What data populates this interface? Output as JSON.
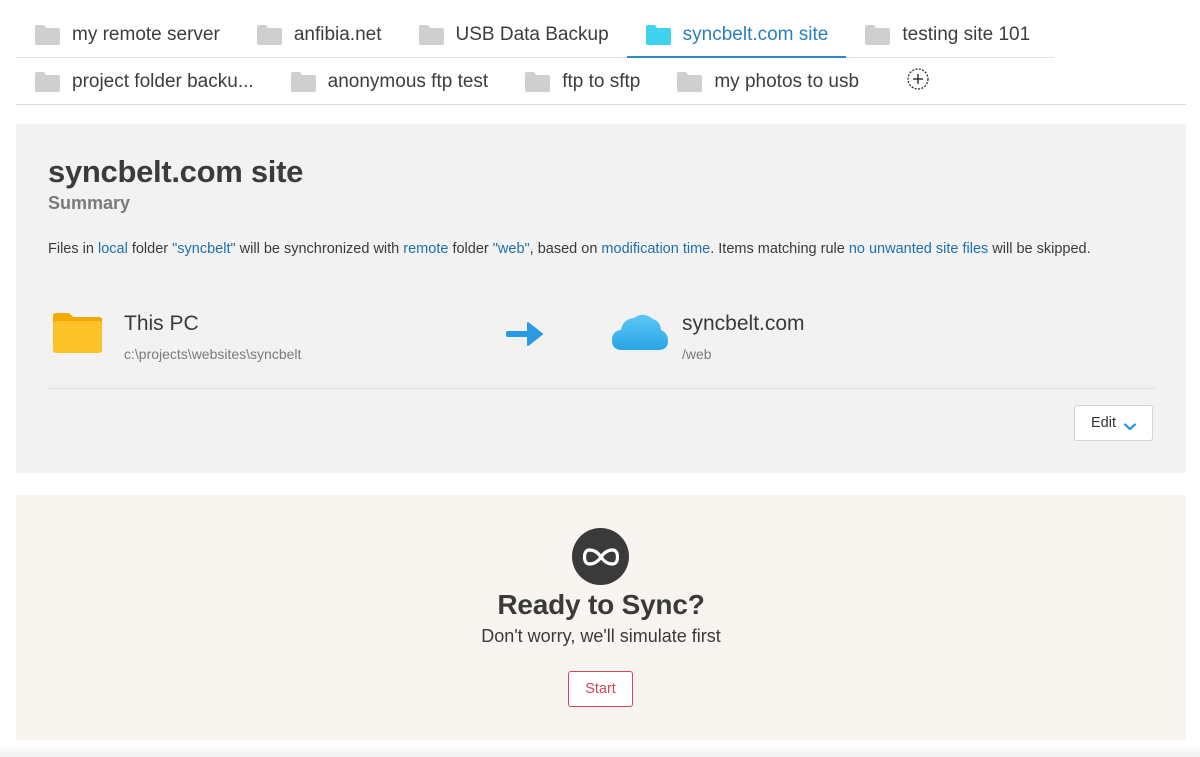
{
  "tabs": {
    "row1": [
      {
        "label": "my remote server",
        "active": false
      },
      {
        "label": "anfibia.net",
        "active": false
      },
      {
        "label": "USB Data Backup",
        "active": false
      },
      {
        "label": "syncbelt.com site",
        "active": true
      },
      {
        "label": "testing site 101",
        "active": false
      }
    ],
    "row2": [
      {
        "label": "project folder backu...",
        "active": false
      },
      {
        "label": "anonymous ftp test",
        "active": false
      },
      {
        "label": "ftp to sftp",
        "active": false
      },
      {
        "label": "my photos to usb",
        "active": false
      }
    ],
    "add_icon": "plus-circle-icon",
    "folder_icon": "folder-icon"
  },
  "summary": {
    "title": "syncbelt.com site",
    "subtitle": "Summary",
    "description": {
      "p1": "Files in ",
      "local": "local",
      "p2": " folder ",
      "local_folder": "\"syncbelt\"",
      "p3": " will be synchronized with ",
      "remote": "remote",
      "p4": " folder ",
      "remote_folder": "\"web\"",
      "p5": ", based on ",
      "compare": "modification time",
      "p6": ". Items matching rule ",
      "rule": "no unwanted site files",
      "p7": " will be skipped."
    },
    "local": {
      "name": "This PC",
      "path": "c:\\projects\\websites\\syncbelt",
      "icon": "folder-icon"
    },
    "remote": {
      "name": "syncbelt.com",
      "path": "/web",
      "icon": "cloud-icon"
    },
    "direction_icon": "arrow-right-icon",
    "edit_label": "Edit"
  },
  "ready": {
    "title": "Ready to Sync?",
    "subtitle": "Don't worry, we'll simulate first",
    "start_label": "Start",
    "icon": "infinity-icon"
  },
  "colors": {
    "accent_blue": "#2a7fbf",
    "link_blue": "#1f6fb0",
    "start_red": "#d6455a",
    "active_folder": "#3fd3f0",
    "inactive_folder": "#cfcfcf",
    "panel_gray": "#f2f2f2",
    "ready_bg": "#f8f4ef"
  }
}
